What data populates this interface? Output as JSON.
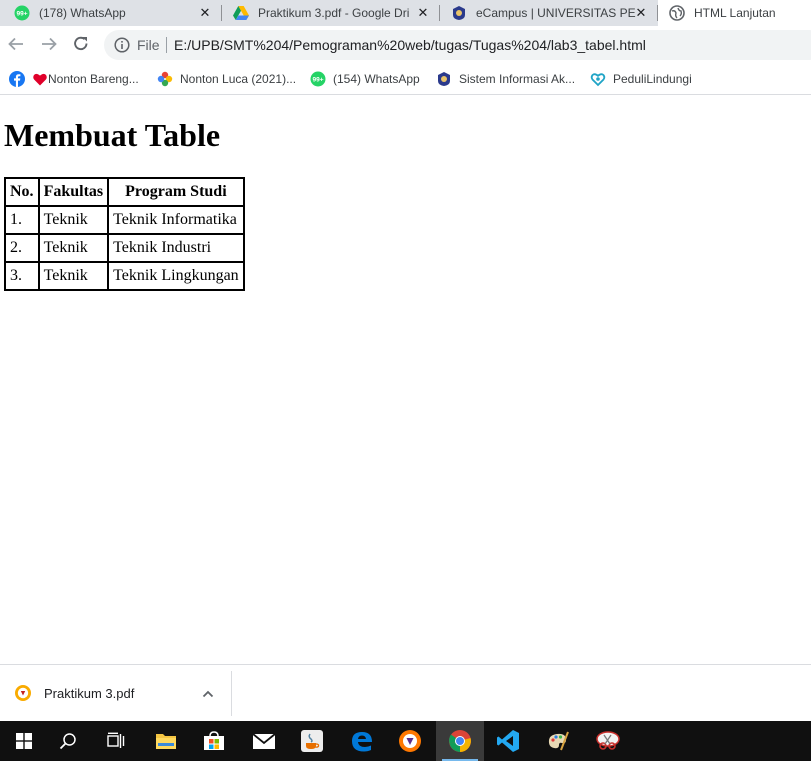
{
  "browser": {
    "tabs": [
      {
        "title": "(178) WhatsApp",
        "icon": "whatsapp-icon",
        "badge": "99+"
      },
      {
        "title": "Praktikum 3.pdf - Google Dri",
        "icon": "google-drive-icon"
      },
      {
        "title": "eCampus | UNIVERSITAS PELI",
        "icon": "university-logo-icon"
      },
      {
        "title": "HTML Lanjutan",
        "icon": "globe-icon"
      }
    ],
    "close_glyph": "✕",
    "address": {
      "scheme_label": "File",
      "url": "E:/UPB/SMT%204/Pemograman%20web/tugas/Tugas%204/lab3_tabel.html"
    },
    "bookmarks": [
      {
        "label": "Nonton Bareng...",
        "icon": "heart-icon"
      },
      {
        "label": "Nonton Luca (2021)...",
        "icon": "pinwheel-icon"
      },
      {
        "label": "(154) WhatsApp",
        "icon": "whatsapp-icon"
      },
      {
        "label": "Sistem Informasi Ak...",
        "icon": "university-logo-icon"
      },
      {
        "label": "PeduliLindungi",
        "icon": "pedulilindungi-icon"
      }
    ]
  },
  "page": {
    "heading": "Membuat Table",
    "table": {
      "headers": [
        "No.",
        "Fakultas",
        "Program Studi"
      ],
      "rows": [
        [
          "1.",
          "Teknik",
          "Teknik Informatika"
        ],
        [
          "2.",
          "Teknik",
          "Teknik Industri"
        ],
        [
          "3.",
          "Teknik",
          "Teknik Lingkungan"
        ]
      ]
    }
  },
  "download_bar": {
    "file_name": "Praktikum 3.pdf"
  },
  "colors": {
    "tabstrip_bg": "#dee1e6",
    "omnibox_bg": "#f1f3f4",
    "taskbar_bg": "#101010",
    "whatsapp_green": "#25d366",
    "facebook_blue": "#1877f2",
    "edge_blue": "#0078d7",
    "vscode_blue": "#23a9f2"
  }
}
